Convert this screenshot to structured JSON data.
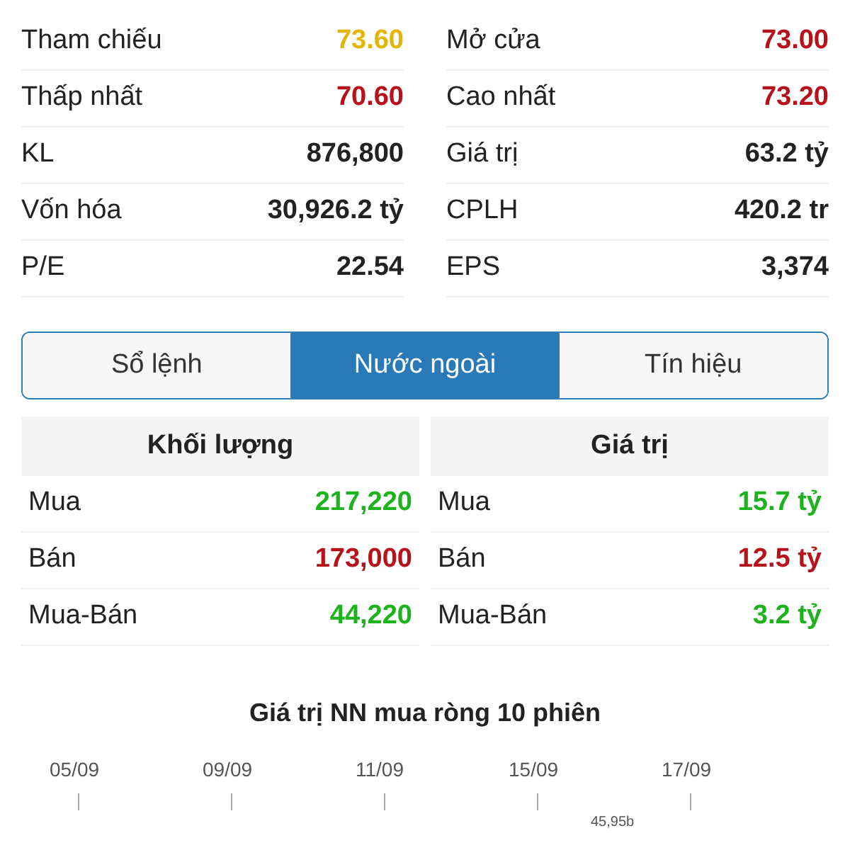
{
  "stats": [
    {
      "label": "Tham chiếu",
      "value": "73.60",
      "color": "#e3b505"
    },
    {
      "label": "Mở cửa",
      "value": "73.00",
      "color": "#b5121b"
    },
    {
      "label": "Thấp nhất",
      "value": "70.60",
      "color": "#b5121b"
    },
    {
      "label": "Cao nhất",
      "value": "73.20",
      "color": "#b5121b"
    },
    {
      "label": "KL",
      "value": "876,800",
      "color": "#222222"
    },
    {
      "label": "Giá trị",
      "value": "63.2 tỷ",
      "color": "#222222"
    },
    {
      "label": "Vốn hóa",
      "value": "30,926.2 tỷ",
      "color": "#222222"
    },
    {
      "label": "CPLH",
      "value": "420.2 tr",
      "color": "#222222"
    },
    {
      "label": "P/E",
      "value": "22.54",
      "color": "#222222"
    },
    {
      "label": "EPS",
      "value": "3,374",
      "color": "#222222"
    }
  ],
  "tabs": [
    {
      "label": "Sổ lệnh",
      "selected": false
    },
    {
      "label": "Nước ngoài",
      "selected": true
    },
    {
      "label": "Tín hiệu",
      "selected": false
    }
  ],
  "foreign": [
    {
      "title": "Khối lượng",
      "rows": [
        {
          "label": "Mua",
          "value": "217,220",
          "color": "#1db31d"
        },
        {
          "label": "Bán",
          "value": "173,000",
          "color": "#b5121b"
        },
        {
          "label": "Mua-Bán",
          "value": "44,220",
          "color": "#1db31d"
        }
      ]
    },
    {
      "title": "Giá trị",
      "rows": [
        {
          "label": "Mua",
          "value": "15.7 tỷ",
          "color": "#1db31d"
        },
        {
          "label": "Bán",
          "value": "12.5 tỷ",
          "color": "#b5121b"
        },
        {
          "label": "Mua-Bán",
          "value": "3.2 tỷ",
          "color": "#1db31d"
        }
      ]
    }
  ],
  "chart": {
    "title": "Giá trị NN mua ròng 10 phiên",
    "xticks": [
      "05/09",
      "09/09",
      "11/09",
      "15/09",
      "17/09"
    ],
    "value_label": "45,95b"
  }
}
